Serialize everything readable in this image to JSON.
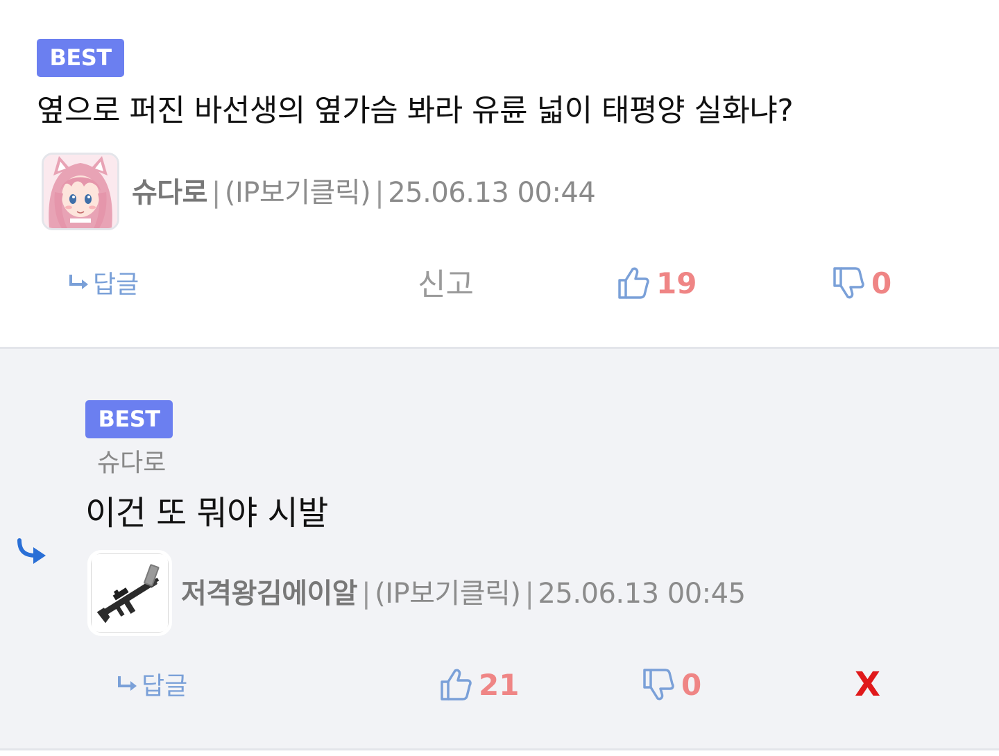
{
  "top_comment": {
    "badge": "BEST",
    "text": "옆으로 퍼진 바선생의 옆가슴 봐라 유륜 넓이 태평양 실화냐?",
    "author": "슈다로",
    "ip_label": "(IP보기클릭)",
    "timestamp": "25.06.13 00:44",
    "reply_label": "답글",
    "report_label": "신고",
    "upvotes": "19",
    "downvotes": "0",
    "avatar_icon": "anime-girl-avatar"
  },
  "reply_comment": {
    "badge": "BEST",
    "reply_to": "슈다로",
    "text": "이건 또 뭐야 시발",
    "author": "저격왕김에이알",
    "ip_label": "(IP보기클릭)",
    "timestamp": "25.06.13 00:45",
    "reply_label": "답글",
    "upvotes": "21",
    "downvotes": "0",
    "delete_label": "X",
    "avatar_icon": "rifle-avatar"
  },
  "colors": {
    "badge": "#6b7ff0",
    "count": "#ef8585",
    "icon_blue": "#7aa0d8",
    "reply_arrow": "#2a6fd6",
    "delete": "#e0191b"
  }
}
